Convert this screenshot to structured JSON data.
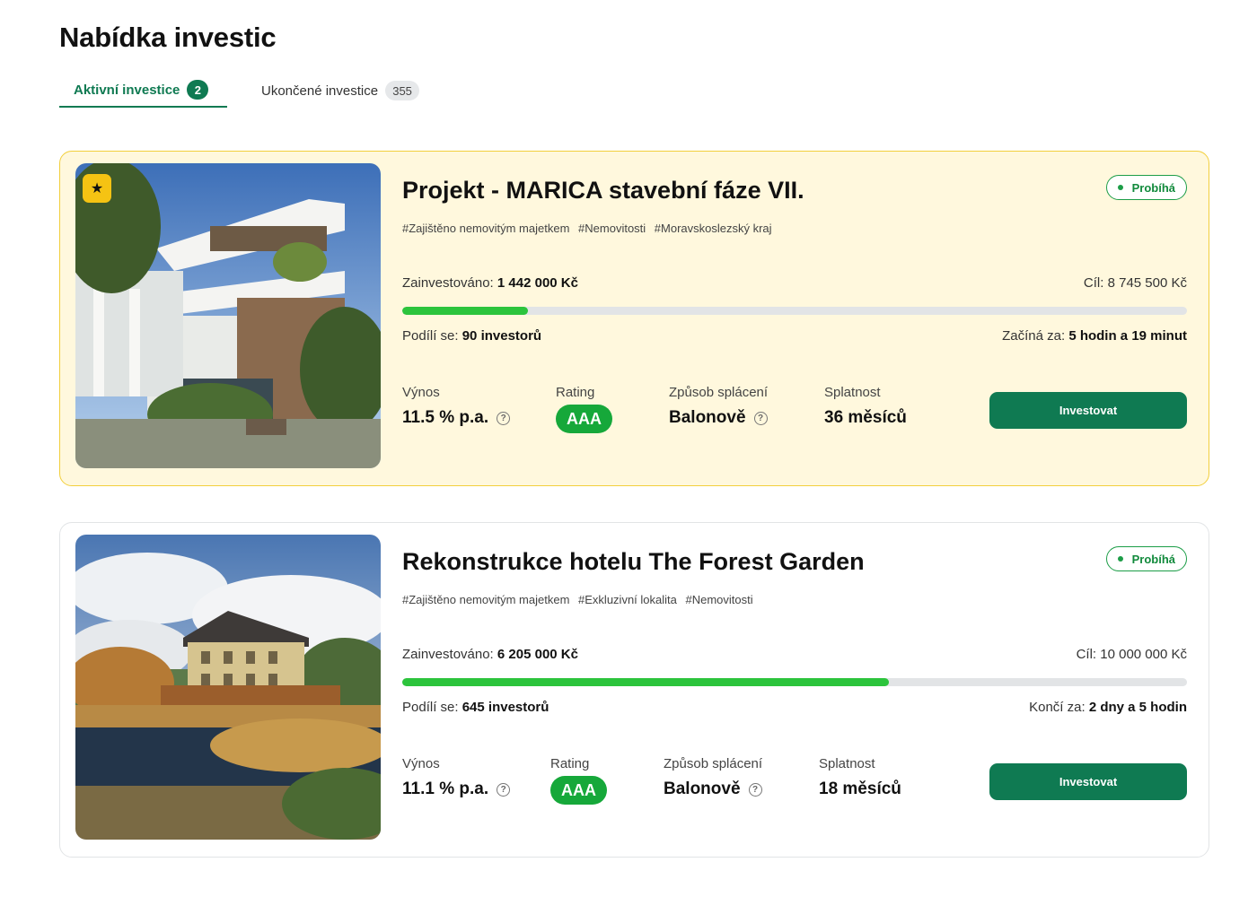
{
  "page": {
    "title": "Nabídka investic"
  },
  "tabs": [
    {
      "label": "Aktivní investice",
      "count": "2",
      "active": true
    },
    {
      "label": "Ukončené investice",
      "count": "355",
      "active": false
    }
  ],
  "colors": {
    "accent": "#0f7a52",
    "progress": "#2cc43c",
    "highlight_card_bg": "#fff8dd",
    "highlight_card_border": "#f2cf3c",
    "rating": "#16a83a"
  },
  "investments": [
    {
      "featured": true,
      "featured_icon": "star-icon",
      "title": "Projekt - MARICA stavební fáze VII.",
      "status": "Probíhá",
      "tags": [
        "#Zajištěno nemovitým majetkem",
        "#Nemovitosti",
        "#Moravskoslezský kraj"
      ],
      "invested_label": "Zainvestováno:",
      "invested_value": "1 442 000 Kč",
      "goal": "Cíl: 8 745 500 Kč",
      "progress_fraction": 0.16,
      "investors_label": "Podílí se:",
      "investors_value": "90 investorů",
      "timer_label": "Začíná za:",
      "timer_value": "5 hodin a 19 minut",
      "yield_label": "Výnos",
      "yield_value": "11.5 % p.a.",
      "rating_label": "Rating",
      "rating_value": "AAA",
      "repayment_label": "Způsob splácení",
      "repayment_value": "Balonově",
      "maturity_label": "Splatnost",
      "maturity_value": "36 měsíců",
      "button_label": "Investovat",
      "help_icon": "question-circle-icon"
    },
    {
      "featured": false,
      "title": "Rekonstrukce hotelu The Forest Garden",
      "status": "Probíhá",
      "tags": [
        "#Zajištěno nemovitým majetkem",
        "#Exkluzivní lokalita",
        "#Nemovitosti"
      ],
      "invested_label": "Zainvestováno:",
      "invested_value": "6 205 000 Kč",
      "goal": "Cíl: 10 000 000 Kč",
      "progress_fraction": 0.62,
      "investors_label": "Podílí se:",
      "investors_value": "645 investorů",
      "timer_label": "Končí za:",
      "timer_value": "2 dny a 5 hodin",
      "yield_label": "Výnos",
      "yield_value": "11.1 % p.a.",
      "rating_label": "Rating",
      "rating_value": "AAA",
      "repayment_label": "Způsob splácení",
      "repayment_value": "Balonově",
      "maturity_label": "Splatnost",
      "maturity_value": "18 měsíců",
      "button_label": "Investovat",
      "help_icon": "question-circle-icon"
    }
  ]
}
